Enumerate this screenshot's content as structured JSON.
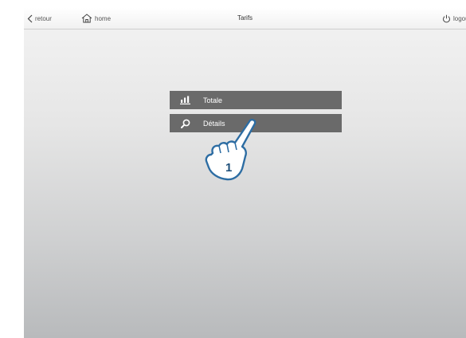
{
  "topbar": {
    "back_label": "retour",
    "home_label": "home",
    "title": "Tarifs",
    "logout_label": "logout"
  },
  "menu": {
    "items": [
      {
        "label": "Totale",
        "icon": "bar-chart-icon"
      },
      {
        "label": "Détails",
        "icon": "search-icon"
      }
    ]
  },
  "annotation": {
    "step": "1"
  },
  "colors": {
    "menu_bg": "#6a6a6a",
    "pointer_stroke": "#2d6da3"
  }
}
